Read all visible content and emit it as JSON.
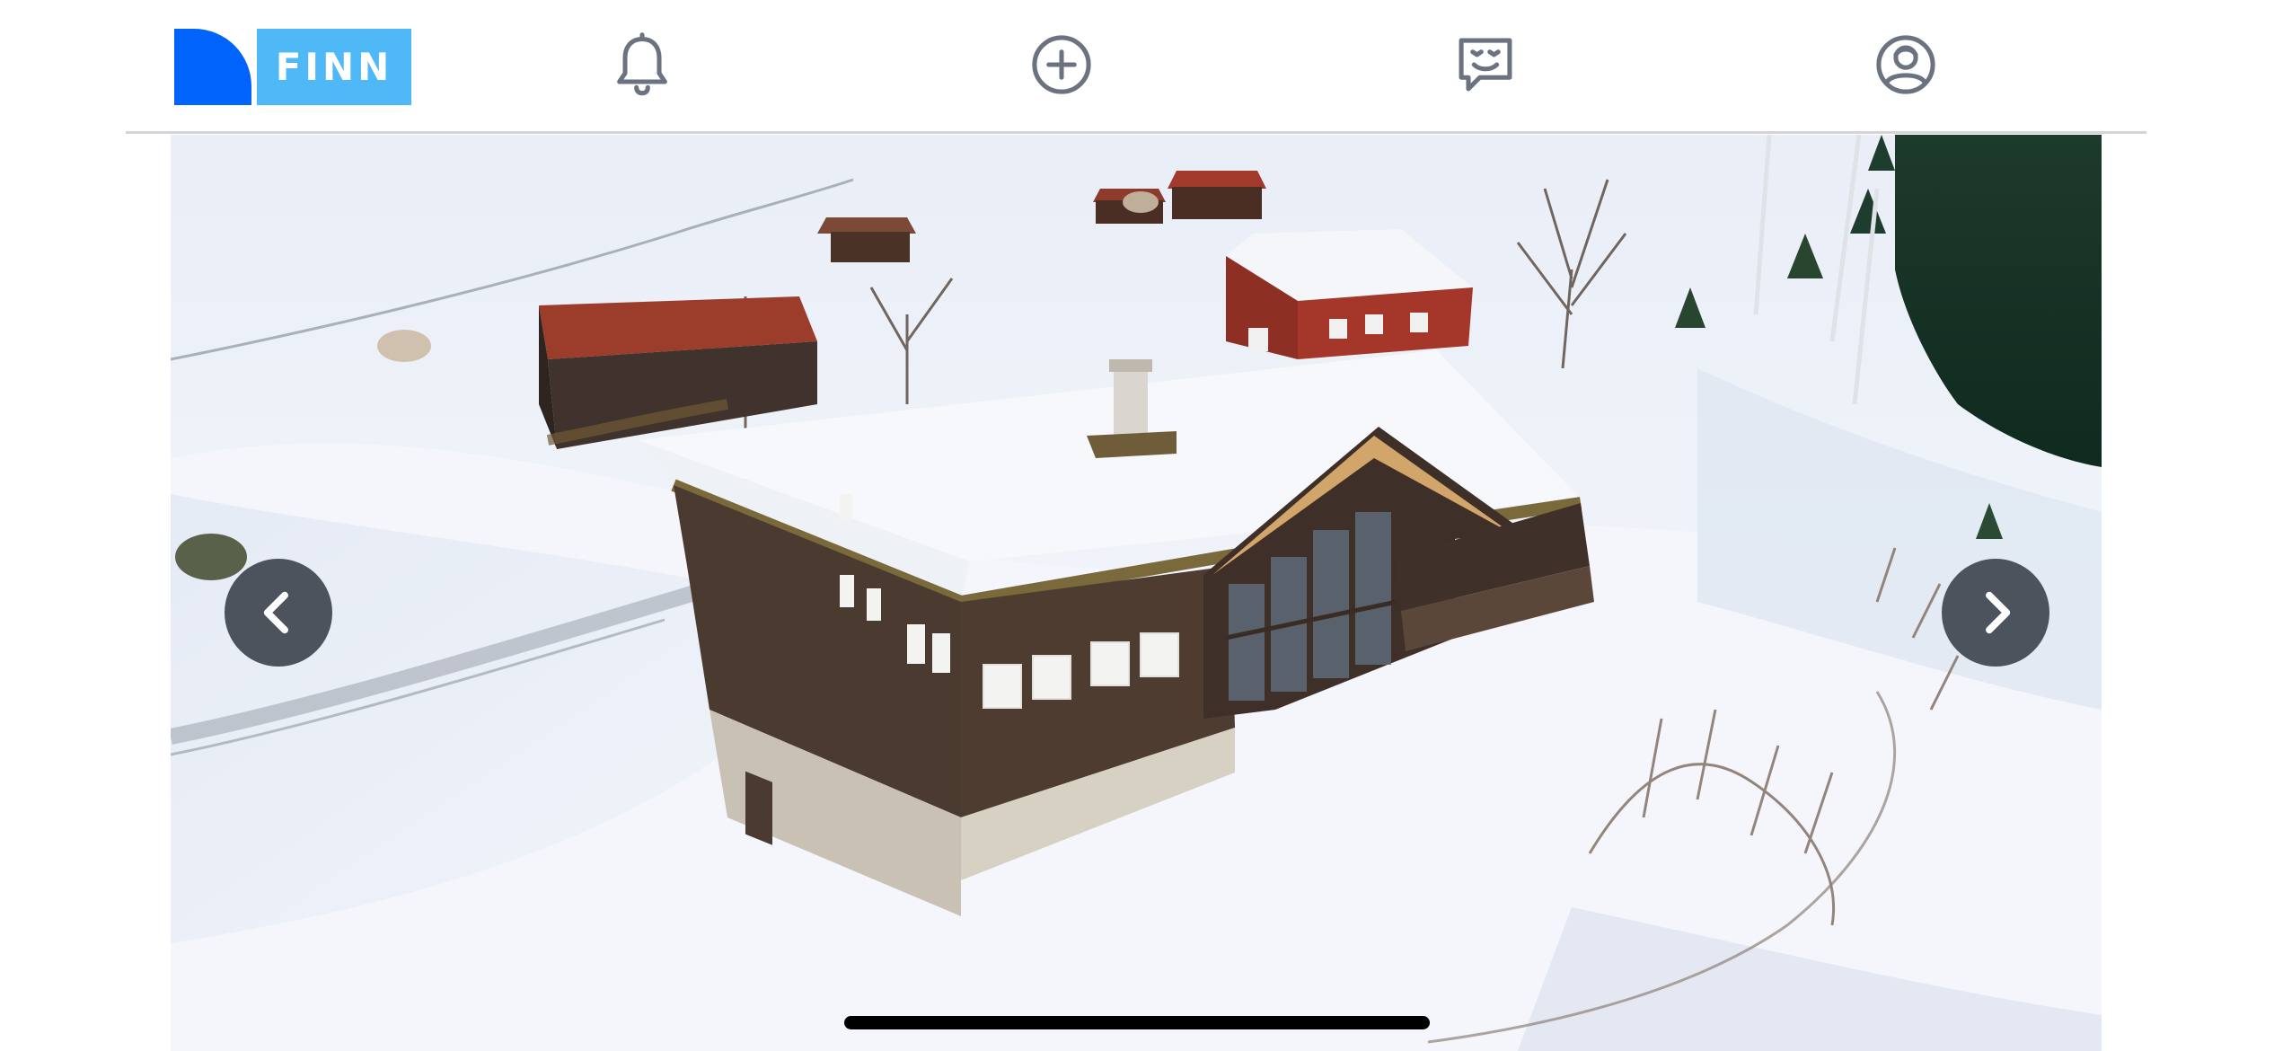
{
  "header": {
    "logo_text": "FINN",
    "brand_colors": {
      "mark": "#0063fb",
      "text_box": "#4fb8f7"
    },
    "icons": [
      {
        "name": "notifications",
        "icon": "bell-icon"
      },
      {
        "name": "new-ad",
        "icon": "plus-circle-icon"
      },
      {
        "name": "messages",
        "icon": "chat-smile-icon"
      },
      {
        "name": "profile",
        "icon": "user-circle-icon"
      }
    ]
  },
  "gallery": {
    "image_subject": "snow-covered-cabin-photo",
    "prev_icon": "chevron-left-icon",
    "next_icon": "chevron-right-icon"
  }
}
